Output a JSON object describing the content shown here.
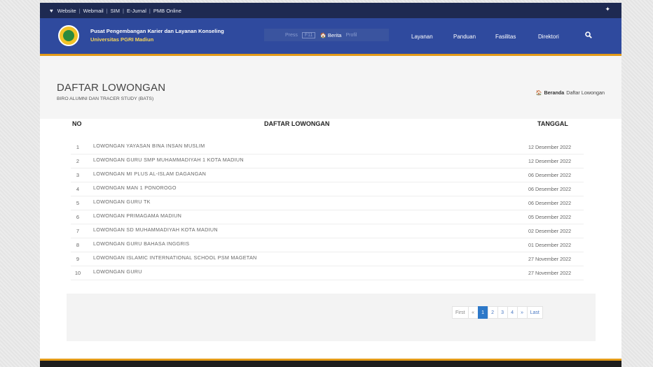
{
  "topbar": {
    "links": [
      "Website",
      "Webmail",
      "SIM",
      "E-Jurnal",
      "PMB Online"
    ]
  },
  "header": {
    "brand_line1": "Pusat Pengembangan Karier dan Layanan Konseling",
    "brand_line2": "Universitas PGRI Madiun",
    "blur_text1": "Press",
    "blur_key": "F11",
    "berita_label": "Berita",
    "profil_label": "Profil",
    "nav": [
      "Layanan",
      "Panduan",
      "Fasilitas",
      "Direktori"
    ]
  },
  "page": {
    "title": "DAFTAR LOWONGAN",
    "subtitle": "BIRO ALUMNI DAN TRACER STUDY (BATS)"
  },
  "breadcrumb": {
    "home": "Beranda",
    "current": "Daftar Lowongan"
  },
  "table": {
    "headers": [
      "NO",
      "DAFTAR LOWONGAN",
      "TANGGAL"
    ],
    "rows": [
      {
        "no": "1",
        "title": "LOWONGAN YAYASAN BINA INSAN MUSLIM",
        "date": "12 Desember 2022"
      },
      {
        "no": "2",
        "title": "LOWONGAN GURU SMP MUHAMMADIYAH 1 KOTA MADIUN",
        "date": "12 Desember 2022"
      },
      {
        "no": "3",
        "title": "LOWONGAN MI PLUS AL-ISLAM DAGANGAN",
        "date": "06 Desember 2022"
      },
      {
        "no": "4",
        "title": "LOWONGAN MAN 1 PONOROGO",
        "date": "06 Desember 2022"
      },
      {
        "no": "5",
        "title": "LOWONGAN GURU TK",
        "date": "06 Desember 2022"
      },
      {
        "no": "6",
        "title": "LOWONGAN PRIMAGAMA MADIUN",
        "date": "05 Desember 2022"
      },
      {
        "no": "7",
        "title": "LOWONGAN SD MUHAMMADIYAH KOTA MADIUN",
        "date": "02 Desember 2022"
      },
      {
        "no": "8",
        "title": "LOWONGAN GURU BAHASA INGGRIS",
        "date": "01 Desember 2022"
      },
      {
        "no": "9",
        "title": "LOWONGAN ISLAMIC INTERNATIONAL SCHOOL PSM MAGETAN",
        "date": "27 November 2022"
      },
      {
        "no": "10",
        "title": "LOWONGAN GURU",
        "date": "27 November 2022"
      }
    ]
  },
  "pagination": {
    "first": "First",
    "prev": "«",
    "pages": [
      "1",
      "2",
      "3",
      "4"
    ],
    "active": "1",
    "next": "»",
    "last": "Last"
  },
  "colors": {
    "topbar": "#1e2a52",
    "header": "#2f4a9e",
    "accent": "#e29a18",
    "active_page": "#2d78c8"
  }
}
